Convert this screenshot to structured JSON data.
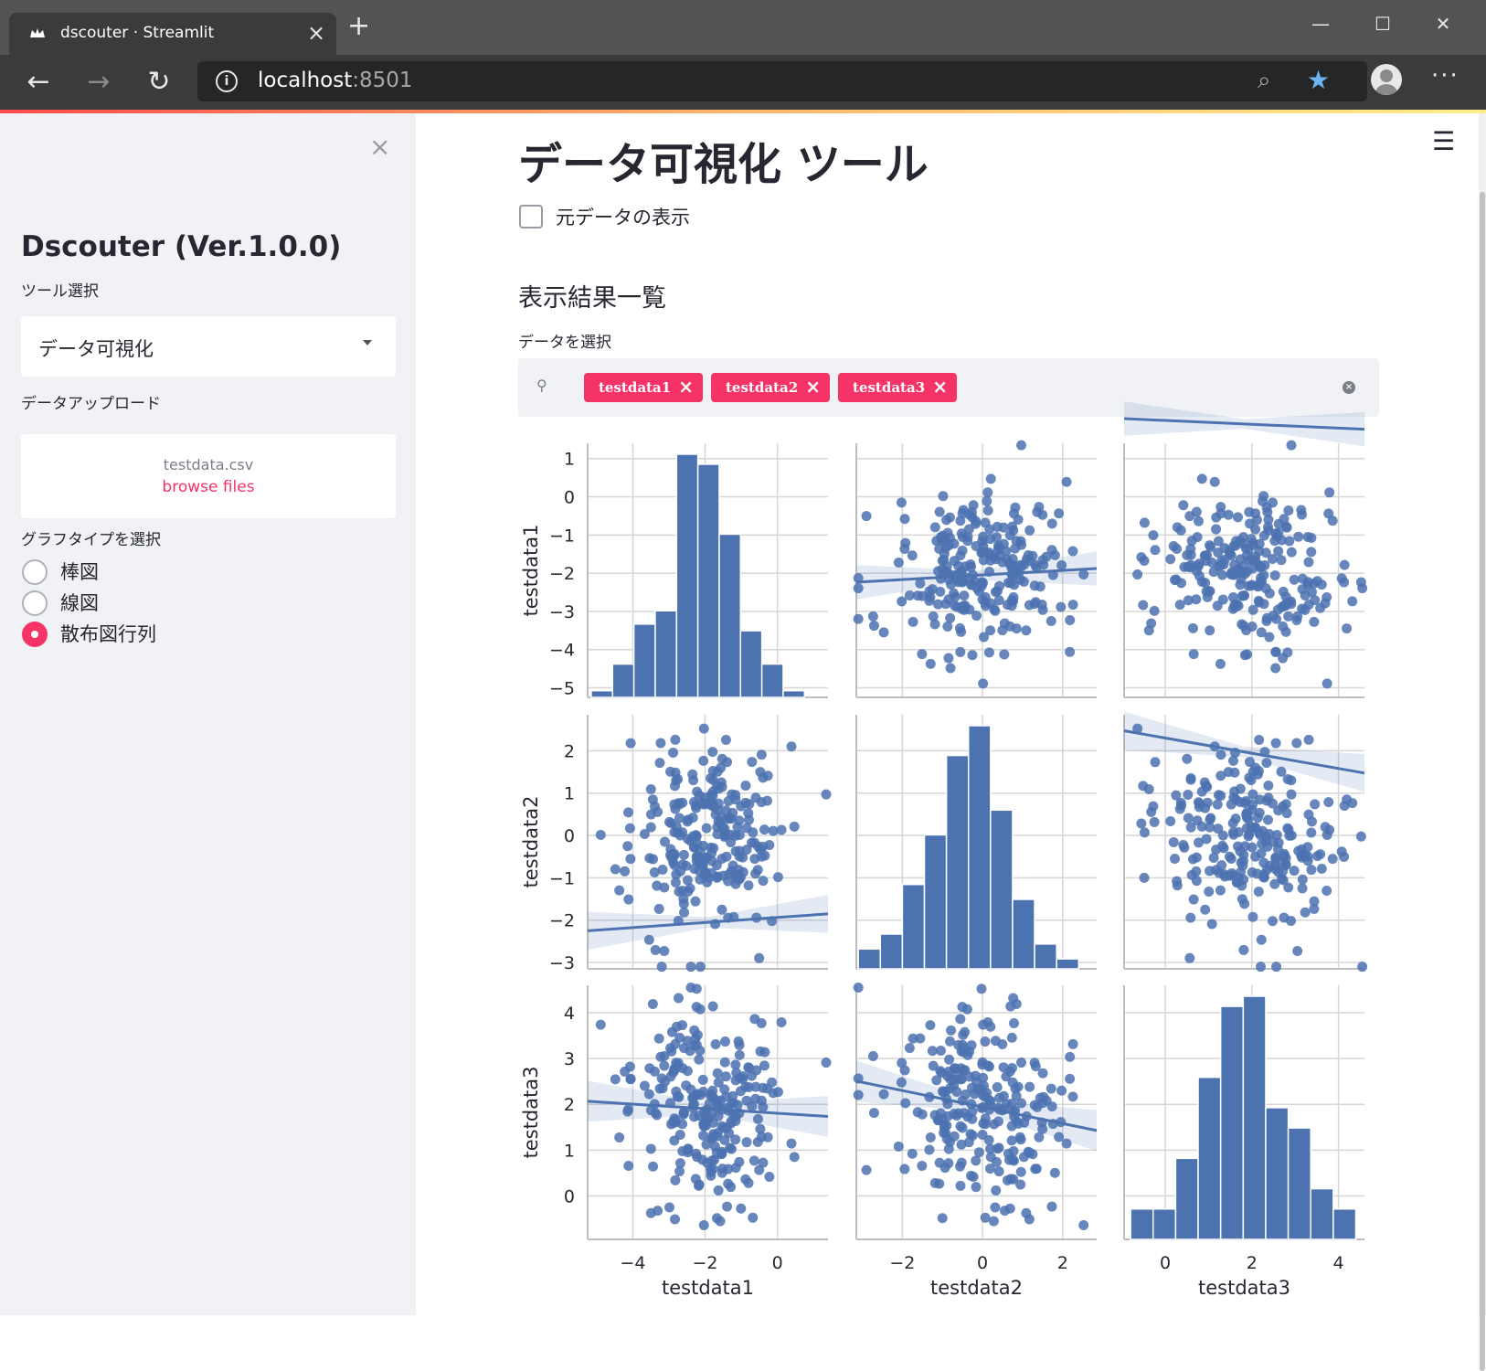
{
  "browser": {
    "tab_title": "dscouter · Streamlit",
    "url_host": "localhost",
    "url_port": ":8501"
  },
  "sidebar": {
    "title": "Dscouter (Ver.1.0.0)",
    "tool_label": "ツール選択",
    "tool_value": "データ可視化",
    "upload_label": "データアップロード",
    "upload_filename": "testdata.csv",
    "upload_browse": "browse files",
    "graph_label": "グラフタイプを選択",
    "graph_options": [
      "棒図",
      "線図",
      "散布図行列"
    ],
    "graph_selected": 2
  },
  "main": {
    "title": "データ可視化 ツール",
    "show_raw_label": "元データの表示",
    "show_raw_checked": false,
    "section_title": "表示結果一覧",
    "data_select_label": "データを選択",
    "selected_data": [
      "testdata1",
      "testdata2",
      "testdata3"
    ]
  },
  "colors": {
    "accent": "#f63366",
    "plot_blue": "#4c72b0",
    "sidebar_bg": "#f0f2f6"
  },
  "icons": [
    "streamlit-favicon-icon",
    "close-icon",
    "plus-icon",
    "back-icon",
    "forward-icon",
    "reload-icon",
    "info-icon",
    "zoom-icon",
    "star-icon",
    "profile-icon",
    "more-icon",
    "hamburger-icon",
    "search-icon",
    "clear-icon",
    "caret-down-icon"
  ],
  "chart_data": {
    "type": "scatter",
    "kind": "pairplot",
    "variables": [
      "testdata1",
      "testdata2",
      "testdata3"
    ],
    "axis_ranges": {
      "testdata1": [
        -5.25,
        1.4
      ],
      "testdata2": [
        -3.15,
        2.85
      ],
      "testdata3": [
        -0.95,
        4.6
      ]
    },
    "ticks": {
      "testdata1": {
        "values": [
          1,
          0,
          -1,
          -2,
          -3,
          -4,
          -5
        ],
        "labels": [
          "1",
          "0",
          "−1",
          "−2",
          "−3",
          "−4",
          "−5"
        ]
      },
      "testdata2": {
        "values": [
          2,
          1,
          0,
          -1,
          -2,
          -3
        ],
        "labels": [
          "2",
          "1",
          "0",
          "−1",
          "−2",
          "−3"
        ]
      },
      "testdata3": {
        "values": [
          4,
          3,
          2,
          1,
          0
        ],
        "labels": [
          "4",
          "3",
          "2",
          "1",
          "0"
        ]
      }
    },
    "x_ticks": {
      "testdata1": {
        "values": [
          -4,
          -2,
          0
        ],
        "labels": [
          "−4",
          "−2",
          "0"
        ]
      },
      "testdata2": {
        "values": [
          -2,
          0,
          2
        ],
        "labels": [
          "−2",
          "0",
          "2"
        ]
      },
      "testdata3": {
        "values": [
          0,
          2,
          4
        ],
        "labels": [
          "0",
          "2",
          "4"
        ]
      }
    },
    "histograms": {
      "testdata1": {
        "bin_start": -5.15,
        "bin_width": 0.59,
        "counts": [
          2,
          10,
          22,
          26,
          73,
          70,
          49,
          20,
          10,
          2
        ]
      },
      "testdata2": {
        "bin_start": -3.1,
        "bin_width": 0.55,
        "counts": [
          4,
          7,
          17,
          27,
          43,
          49,
          32,
          14,
          5,
          2
        ]
      },
      "testdata3": {
        "bin_start": -0.8,
        "bin_width": 0.52,
        "counts": [
          3,
          3,
          8,
          16,
          23,
          24,
          13,
          11,
          5,
          3
        ]
      },
      "counts_scale": "relative"
    },
    "regressions": {
      "1v2": {
        "slope": 0.06,
        "intercept": -2.05
      },
      "1v3": {
        "slope": -0.05,
        "intercept": 1.9
      },
      "2v3": {
        "slope": -0.18,
        "intercept": 1.95
      }
    },
    "n_points": 240,
    "grid": true,
    "marker_color": "#4c72b0"
  }
}
